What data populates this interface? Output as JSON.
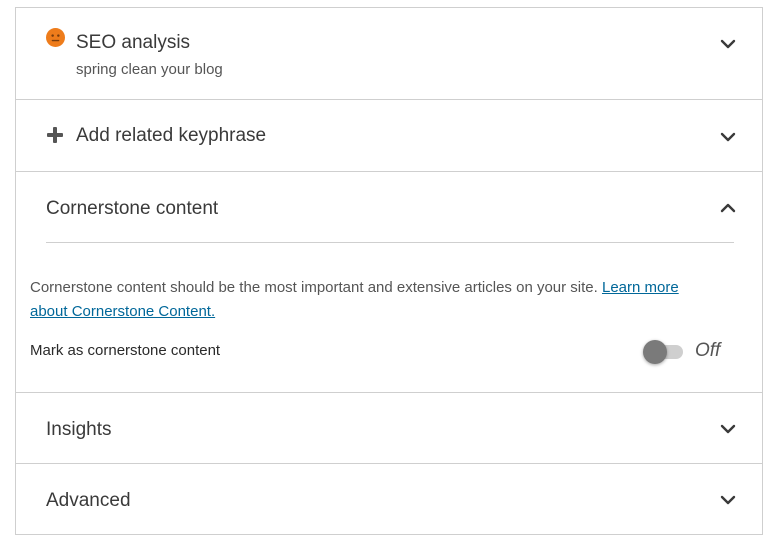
{
  "seo": {
    "title": "SEO analysis",
    "subtitle": "spring clean your blog",
    "status_color": "#ee7c1b",
    "icon": "neutral-face-icon"
  },
  "related": {
    "title": "Add related keyphrase",
    "icon": "plus-icon"
  },
  "cornerstone": {
    "title": "Cornerstone content",
    "description": "Cornerstone content should be the most important and extensive articles on your site.",
    "link_text": "Learn more about Cornerstone Content.",
    "mark_label": "Mark as cornerstone content",
    "toggle_state": "Off"
  },
  "insights": {
    "title": "Insights"
  },
  "advanced": {
    "title": "Advanced"
  },
  "colors": {
    "link": "#006799",
    "border": "#cfcfcf"
  }
}
